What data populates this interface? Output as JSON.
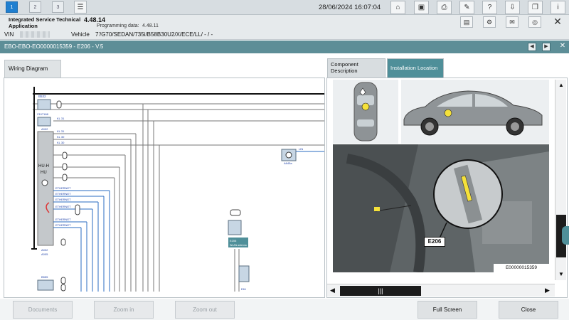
{
  "topbar": {
    "tabs": [
      "1",
      "2",
      "3"
    ],
    "datetime": "28/06/2024 16:07:04"
  },
  "app": {
    "name": "Integrated Service Technical Application",
    "version": "4.48.14",
    "programming_label": "Programming data:",
    "programming_value": "4.48.11"
  },
  "vehicle": {
    "vin_label": "VIN",
    "label": "Vehicle",
    "value": "7'/G70/SEDAN/735i/B58B30U2/X/ECE/LL/ - / -"
  },
  "titlebar": {
    "title": "EBO-EBO-EO0000015359 - E206 - V.5"
  },
  "tabs": {
    "wiring": "Wiring Diagram",
    "component": "Component Description",
    "install": "Installation Location"
  },
  "diagram": {
    "labels": {
      "a": "B532",
      "b": "Z107188",
      "c": "A002",
      "d": "KL 31",
      "e": "KL 30",
      "f": "HU-H",
      "g": "HU",
      "h": "ETHERNET",
      "i": "E206",
      "j": "WLAN antenna",
      "k": "E61",
      "l": "A645a",
      "m": "LIN",
      "n": "B555",
      "o": "A002",
      "p": "A005"
    }
  },
  "install": {
    "callout": "E206",
    "image_id": "E00000015359"
  },
  "footer": {
    "documents": "Documents",
    "zoom_in": "Zoom in",
    "zoom_out": "Zoom out",
    "full_screen": "Full Screen",
    "close": "Close"
  }
}
